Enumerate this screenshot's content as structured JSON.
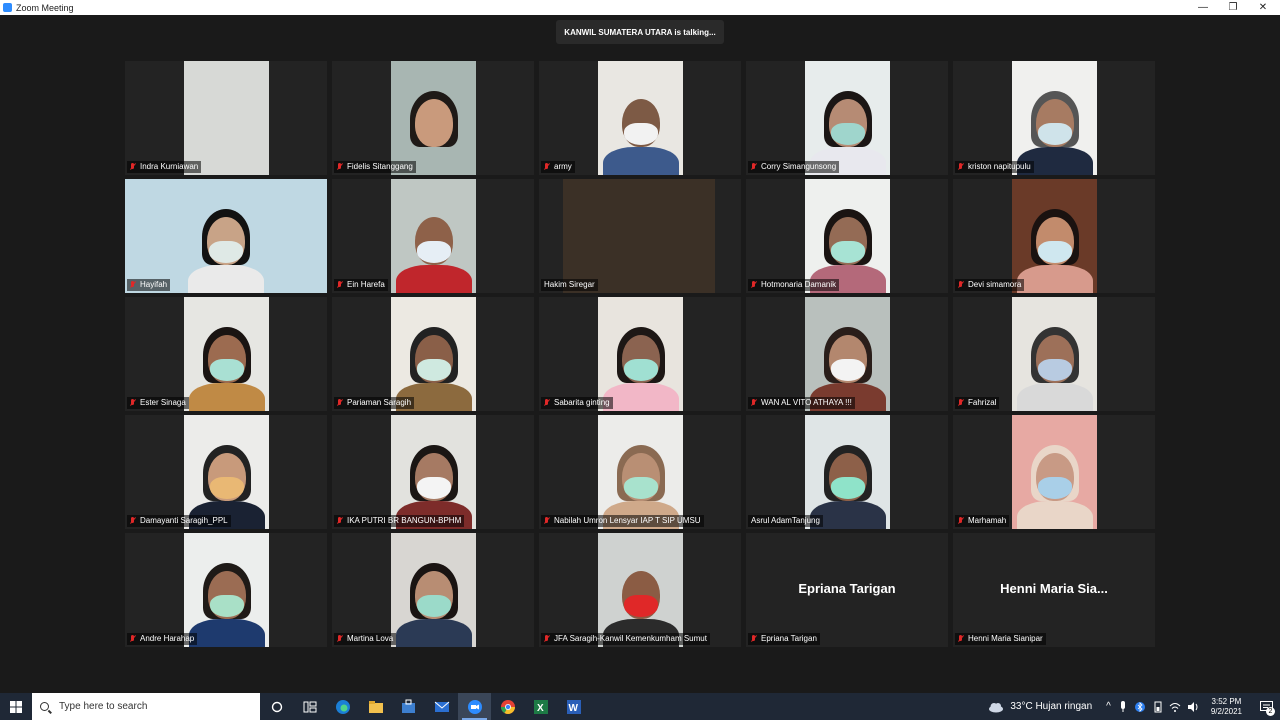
{
  "window": {
    "title": "Zoom Meeting",
    "minimize": "—",
    "restore": "❐",
    "close": "✕"
  },
  "banner": {
    "text": "KANWIL SUMATERA UTARA is talking..."
  },
  "participants": [
    {
      "name": "Indra Kurniawan",
      "muted": true
    },
    {
      "name": "Fidelis Sitanggang",
      "muted": true
    },
    {
      "name": "army",
      "muted": true
    },
    {
      "name": "Corry Simangunsong",
      "muted": true
    },
    {
      "name": "kriston napitupulu",
      "muted": true
    },
    {
      "name": "Hayifah",
      "muted": true
    },
    {
      "name": "Ein Harefa",
      "muted": true
    },
    {
      "name": "Hakim Siregar",
      "muted": false
    },
    {
      "name": "Hotmonaria Damanik",
      "muted": true
    },
    {
      "name": "Devi simamora",
      "muted": true
    },
    {
      "name": "Ester Sinaga",
      "muted": true
    },
    {
      "name": "Pariaman Saragih",
      "muted": true
    },
    {
      "name": "Sabarita ginting",
      "muted": true
    },
    {
      "name": "WAN AL VITO ATHAYA !!!",
      "muted": true
    },
    {
      "name": "Fahrizal",
      "muted": true
    },
    {
      "name": "Damayanti Saragih_PPL",
      "muted": true
    },
    {
      "name": "IKA PUTRI BR BANGUN-BPHM",
      "muted": true
    },
    {
      "name": "Nabilah Umron Lensyar IAP T SIP UMSU",
      "muted": true
    },
    {
      "name": "Asrul AdamTanjung",
      "muted": false
    },
    {
      "name": "Marhamah",
      "muted": true
    },
    {
      "name": "Andre Harahap",
      "muted": true
    },
    {
      "name": "Martina Lova",
      "muted": true
    },
    {
      "name": "JFA Saragih-Kanwil Kemenkumham Sumut",
      "muted": true
    },
    {
      "name": "Epriana Tarigan",
      "muted": true,
      "display": "Epriana Tarigan"
    },
    {
      "name": "Henni Maria Sianipar",
      "muted": true,
      "display": "Henni Maria Sia..."
    }
  ],
  "taskbar": {
    "search_placeholder": "Type here to search",
    "weather": "33°C  Hujan ringan",
    "time": "3:52 PM",
    "date": "9/2/2021",
    "notifications": "2"
  },
  "colors": {
    "zoom_blue": "#2d8cff",
    "mute_red": "#e02828",
    "taskbar": "#1f2836"
  }
}
